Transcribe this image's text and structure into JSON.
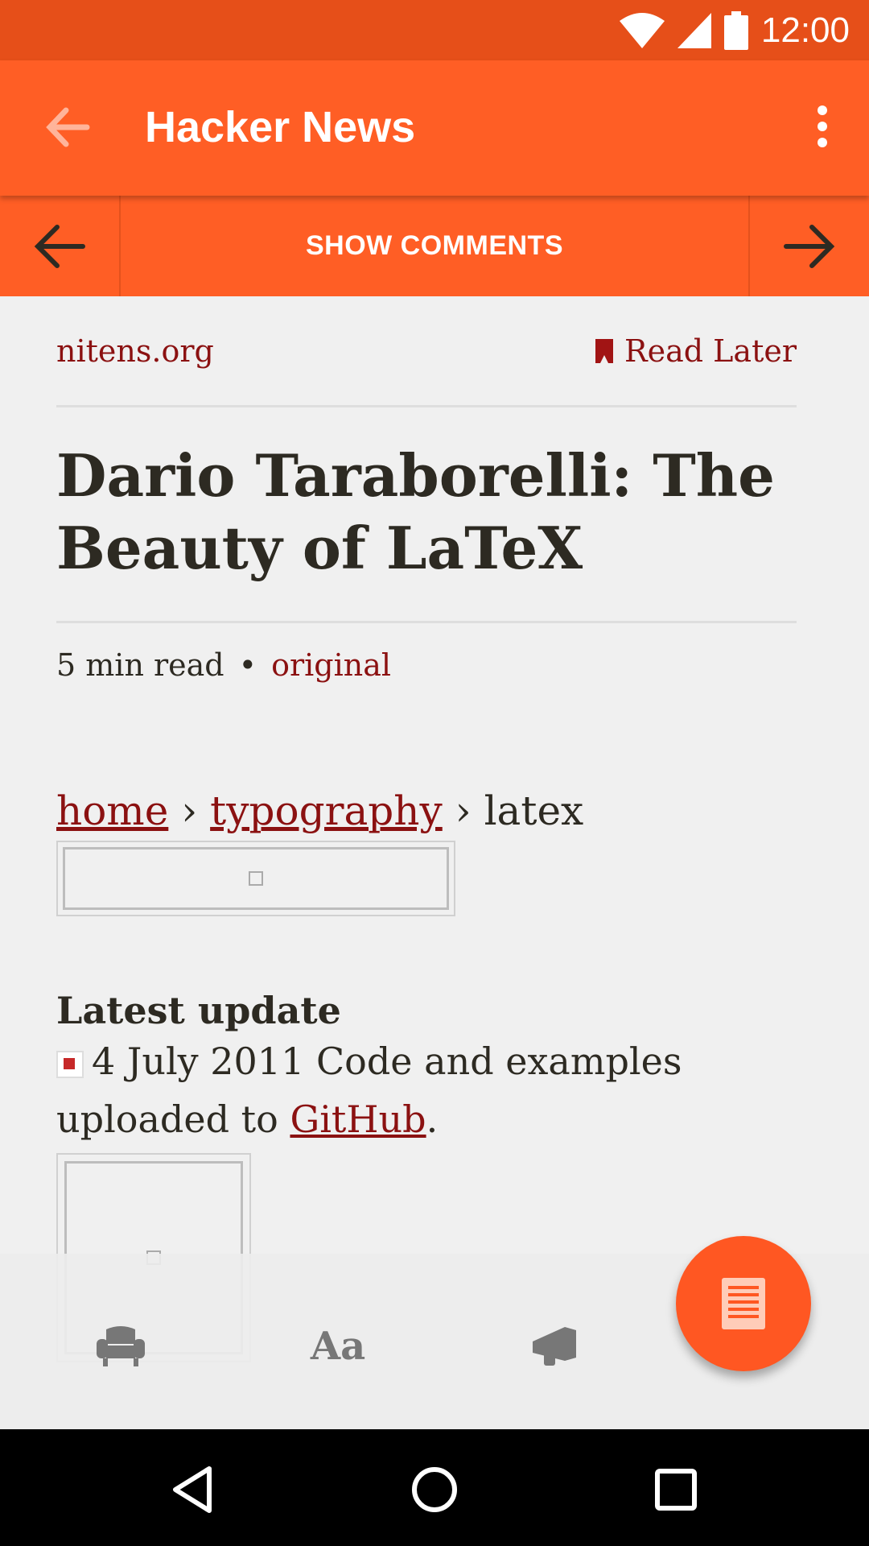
{
  "status": {
    "time": "12:00"
  },
  "app_bar": {
    "title": "Hacker News"
  },
  "comments_bar": {
    "label": "SHOW COMMENTS"
  },
  "article": {
    "source": "nitens.org",
    "read_later": "Read Later",
    "title": "Dario Taraborelli: The Beauty of LaTeX",
    "read_time": "5 min read",
    "separator": "•",
    "original": "original"
  },
  "breadcrumb": {
    "home": "home",
    "sep1": "›",
    "typography": "typography",
    "sep2": "›",
    "current": "latex"
  },
  "latest_update": {
    "heading": "Latest update",
    "text": "4 July 2011 Code and examples uploaded to ",
    "link": "GitHub",
    "end": "."
  },
  "toolbar_icons": [
    "armchair-icon",
    "text-size-icon",
    "megaphone-icon"
  ],
  "fab_icon": "reader-icon",
  "colors": {
    "accent": "#ff5e25",
    "status_bar": "#e64f19",
    "link": "#8b1111"
  }
}
